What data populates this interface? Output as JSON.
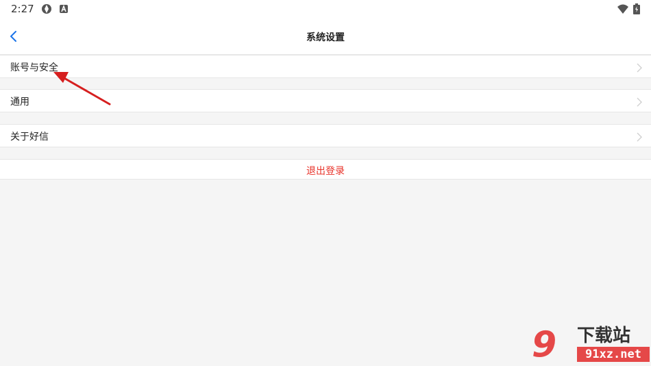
{
  "status_bar": {
    "time": "2:27",
    "icons": [
      "sync-icon",
      "a-notification-icon",
      "wifi-icon",
      "battery-icon"
    ]
  },
  "header": {
    "title": "系统设置",
    "back_icon": "chevron-left-icon"
  },
  "settings": {
    "items": [
      {
        "label": "账号与安全"
      },
      {
        "label": "通用"
      },
      {
        "label": "关于好信"
      }
    ],
    "logout_label": "退出登录"
  },
  "colors": {
    "accent_blue": "#1a73e8",
    "logout_red": "#e8332a",
    "background": "#f5f5f5",
    "annotation_arrow": "#d61f1f"
  },
  "watermark": {
    "logo_number": "9",
    "logo_text": "下载站",
    "domain": "91xz.net"
  }
}
